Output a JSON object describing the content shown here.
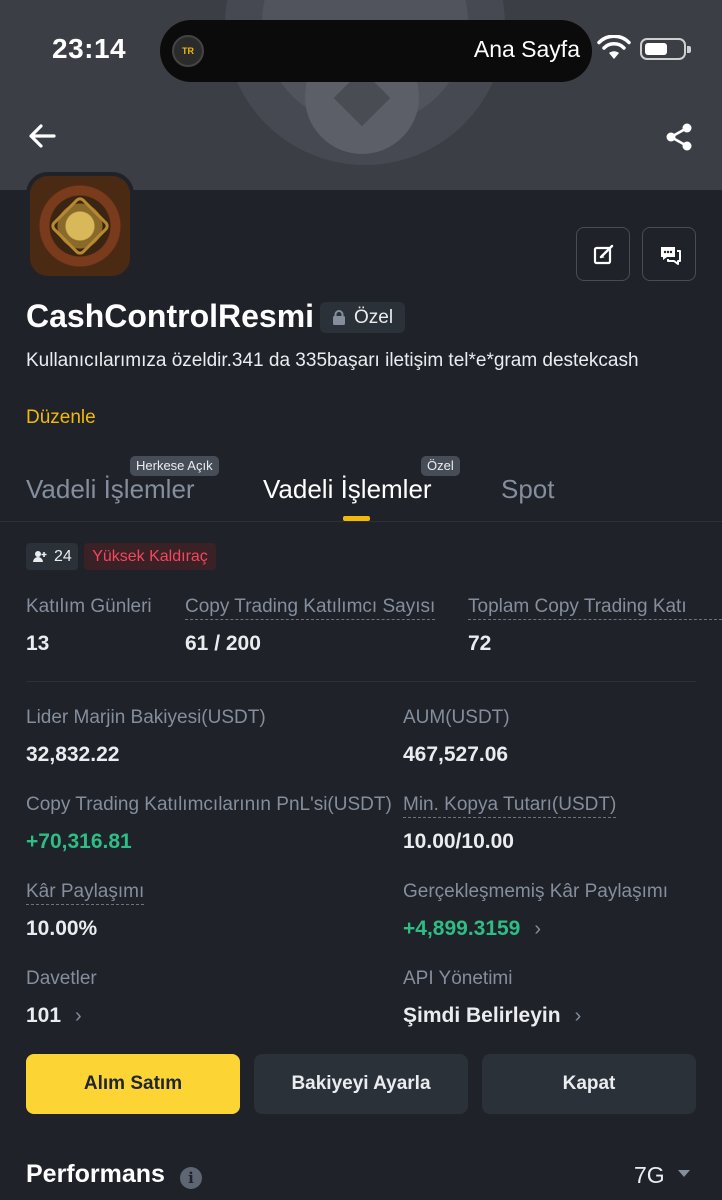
{
  "status_bar": {
    "time": "23:14",
    "island_badge": "TR",
    "island_label": "Ana Sayfa"
  },
  "profile": {
    "name": "CashControlResmi",
    "badge": "Özel",
    "bio": "Kullanıcılarımıza özeldir.341 da  335başarı iletişim tel*e*gram destekcash",
    "edit_link": "Düzenle"
  },
  "tabs": [
    {
      "label": "Vadeli İşlemler",
      "tag": "Herkese Açık",
      "active": false
    },
    {
      "label": "Vadeli İşlemler",
      "tag": "Özel",
      "active": true
    },
    {
      "label": "Spot",
      "tag": "",
      "active": false
    }
  ],
  "chips": {
    "copiers": "24",
    "leverage": "Yüksek Kaldıraç"
  },
  "stats_top": [
    {
      "label": "Katılım Günleri",
      "value": "13"
    },
    {
      "label": "Copy Trading Katılımcı Sayısı",
      "value": "61 / 200"
    },
    {
      "label": "Toplam Copy Trading Katı",
      "value": "72"
    }
  ],
  "stats": {
    "lead_margin": {
      "label": "Lider Marjin Bakiyesi(USDT)",
      "value": "32,832.22"
    },
    "aum": {
      "label": "AUM(USDT)",
      "value": "467,527.06"
    },
    "copier_pnl": {
      "label": "Copy Trading Katılımcılarının PnL'si(USDT)",
      "value": "+70,316.81"
    },
    "min_copy": {
      "label": "Min. Kopya Tutarı(USDT)",
      "value": "10.00/10.00"
    },
    "profit_share": {
      "label": "Kâr Paylaşımı",
      "value": "10.00%"
    },
    "unrealized_share": {
      "label": "Gerçekleşmemiş Kâr Paylaşımı",
      "value": "+4,899.3159"
    },
    "invites": {
      "label": "Davetler",
      "value": "101"
    },
    "api": {
      "label": "API Yönetimi",
      "value": "Şimdi Belirleyin"
    }
  },
  "actions": {
    "trade": "Alım Satım",
    "adjust": "Bakiyeyi Ayarla",
    "close": "Kapat"
  },
  "performance": {
    "title": "Performans",
    "period": "7G"
  },
  "colors": {
    "accent": "#f0b90b",
    "button": "#fcd535",
    "positive": "#2ebd85",
    "negative": "#f6465d",
    "background": "#1f2229"
  }
}
